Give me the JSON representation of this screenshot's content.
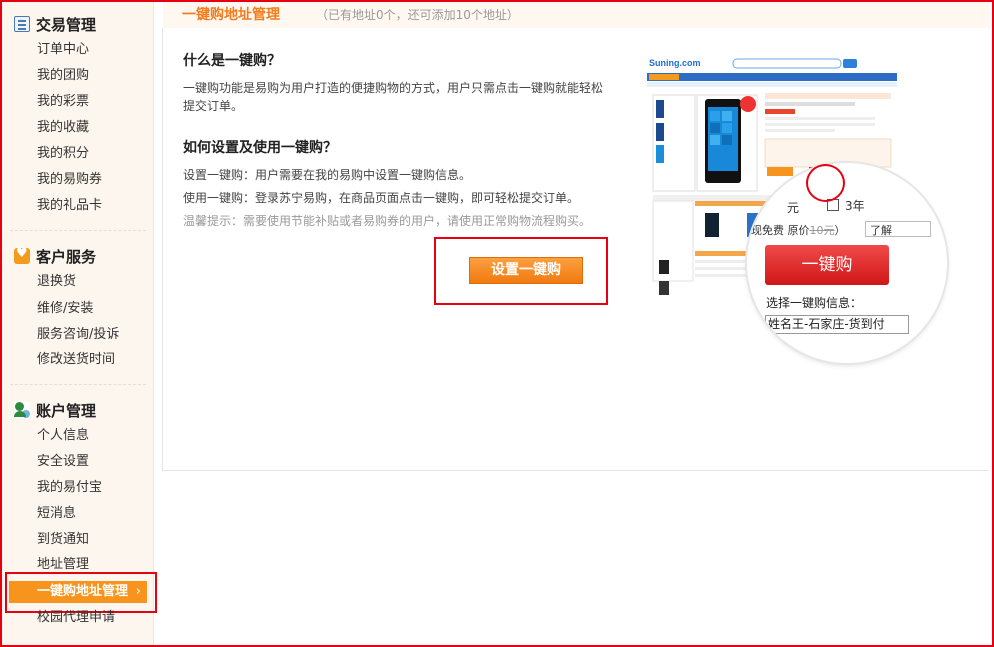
{
  "sidebar": {
    "sections": [
      {
        "title": "交易管理",
        "icon": "trade-list-icon",
        "items": [
          "订单中心",
          "我的团购",
          "我的彩票",
          "我的收藏",
          "我的积分",
          "我的易购券",
          "我的礼品卡"
        ]
      },
      {
        "title": "客户服务",
        "icon": "heart-icon",
        "items": [
          "退换货",
          "维修/安装",
          "服务咨询/投诉",
          "修改送货时间"
        ]
      },
      {
        "title": "账户管理",
        "icon": "user-settings-icon",
        "items": [
          "个人信息",
          "安全设置",
          "我的易付宝",
          "短消息",
          "到货通知",
          "地址管理",
          "一键购地址管理",
          "校园代理申请"
        ]
      }
    ],
    "active_item": "一键购地址管理",
    "active_chevron": "›"
  },
  "header": {
    "title": "一键购地址管理",
    "subtitle": "（已有地址0个，还可添加10个地址）"
  },
  "main": {
    "q1_title": "什么是一键购？",
    "q1_body": "一键购功能是易购为用户打造的便捷购物的方式，用户只需点击一键购就能轻松提交订单。",
    "q2_title": "如何设置及使用一键购？",
    "line_setup": "设置一键购：用户需要在我的易购中设置一键购信息。",
    "line_use": "使用一键购：登录苏宁易购，在商品页面点击一键购，即可轻松提交订单。",
    "line_tip": "温馨提示：需要使用节能补贴或者易购券的用户，请使用正常购物流程购买。",
    "setup_button": "设置一键购"
  },
  "illustration": {
    "logo": "Suning.com",
    "zoom_price_fragment": "元",
    "zoom_year_fragment": "3年",
    "zoom_free_prefix": "现免费",
    "zoom_original_label": "原价",
    "zoom_original_price": "10元",
    "zoom_free_suffix": "）",
    "zoom_learn_more": "了解",
    "zoom_button": "一键购",
    "zoom_select_label": "选择一键购信息：",
    "zoom_input_value": "姓名王-石家庄-货到付"
  },
  "colors": {
    "accent_orange": "#f7941d",
    "title_orange": "#f37b1d",
    "highlight_red": "#e60012",
    "sidebar_bg": "#fdf6ef"
  }
}
